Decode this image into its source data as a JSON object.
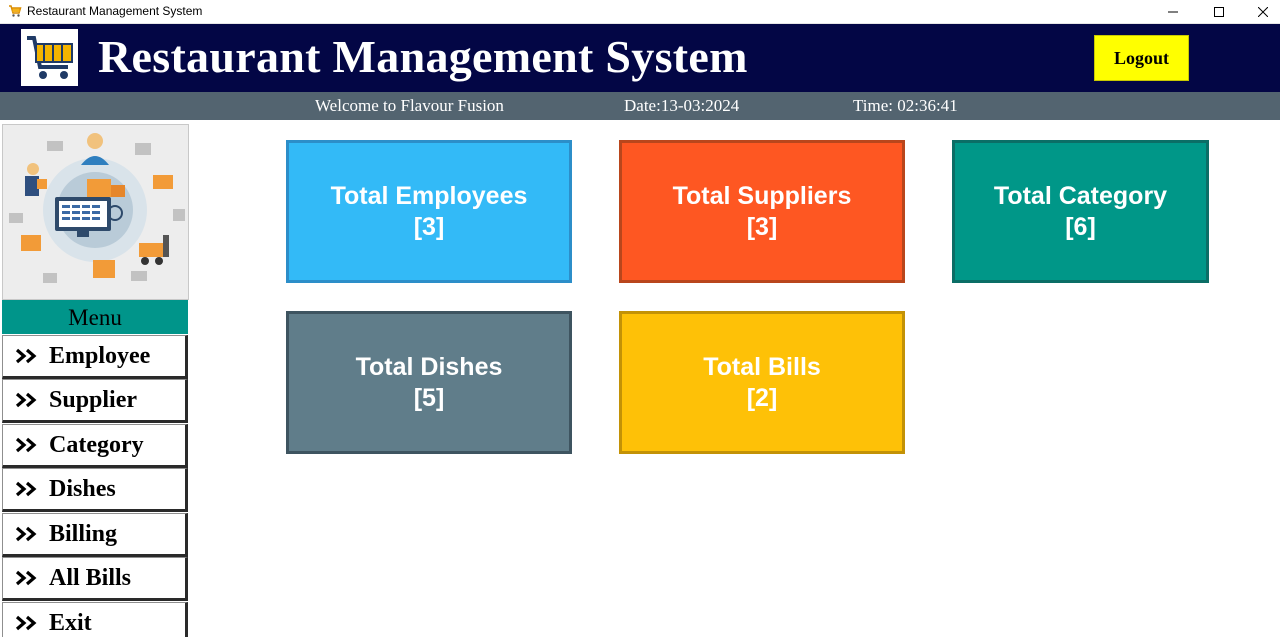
{
  "window": {
    "title": "Restaurant Management System",
    "controls": {
      "minimize_icon": "minimize-icon",
      "maximize_icon": "maximize-icon",
      "close_icon": "close-icon"
    }
  },
  "header": {
    "title": "Restaurant Management System",
    "logo_icon": "shopping-cart-icon",
    "logout_label": "Logout",
    "colors": {
      "background": "#030645",
      "title": "#ffffff",
      "logout_bg": "#ffff00"
    }
  },
  "status": {
    "welcome": "Welcome to Flavour Fusion",
    "date": "Date:13-03:2024",
    "time": "Time: 02:36:41",
    "background": "#536470"
  },
  "sidebar": {
    "image_icon": "logistics-illustration",
    "menu_label": "Menu",
    "menu_color": "#00958a",
    "items": [
      {
        "label": "Employee"
      },
      {
        "label": "Supplier"
      },
      {
        "label": "Category"
      },
      {
        "label": "Dishes"
      },
      {
        "label": "Billing"
      },
      {
        "label": "All Bills"
      },
      {
        "label": "Exit"
      }
    ]
  },
  "cards": [
    {
      "title": "Total Employees",
      "count": "[3]",
      "color": "#33baf7",
      "border": "#2c8ec9"
    },
    {
      "title": "Total Suppliers",
      "count": "[3]",
      "color": "#fe5722",
      "border": "#b9461c"
    },
    {
      "title": "Total Category",
      "count": "[6]",
      "color": "#009788",
      "border": "#0b6e66"
    },
    {
      "title": "Total Dishes",
      "count": "[5]",
      "color": "#607d8a",
      "border": "#3e5460"
    },
    {
      "title": "Total Bills",
      "count": "[2]",
      "color": "#fec107",
      "border": "#c39206"
    }
  ]
}
